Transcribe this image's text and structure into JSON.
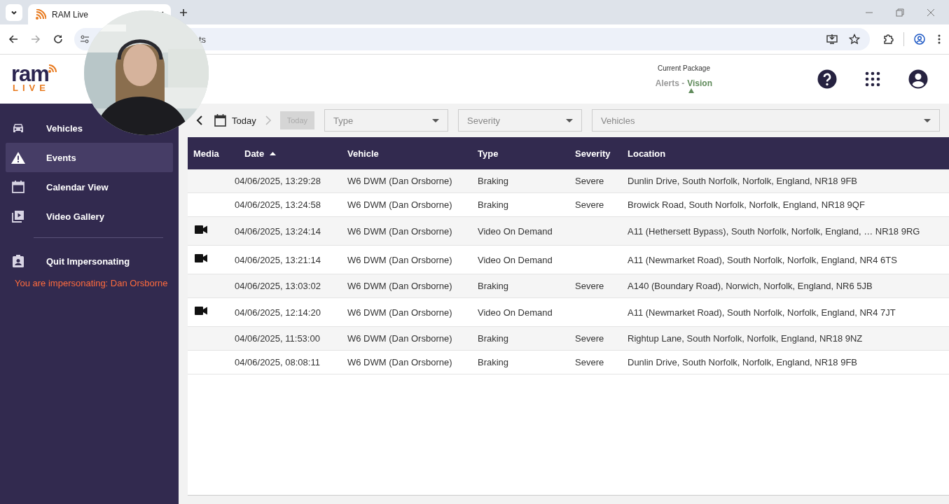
{
  "browser": {
    "tab_title": "RAM Live",
    "address": "ts"
  },
  "header": {
    "package_label": "Current Package",
    "package_base": "Alerts",
    "package_separator": "-",
    "package_tier": "Vision"
  },
  "logo": {
    "word": "ram",
    "sub": "LIVE"
  },
  "sidebar": {
    "items": [
      {
        "label": "Vehicles",
        "kind": "car",
        "selected": false
      },
      {
        "label": "Events",
        "kind": "warning",
        "selected": true
      },
      {
        "label": "Calendar View",
        "kind": "calendar",
        "selected": false
      },
      {
        "label": "Video Gallery",
        "kind": "video",
        "selected": false
      }
    ],
    "quit": {
      "label": "Quit Impersonating"
    },
    "notice": "You are impersonating: Dan Orsborne"
  },
  "filters": {
    "date": "Today",
    "date_end": "Today",
    "type": "Type",
    "severity": "Severity",
    "vehicles": "Vehicles"
  },
  "table": {
    "columns": [
      {
        "label": "Media",
        "sorted": false
      },
      {
        "label": "Date",
        "sorted": true
      },
      {
        "label": "Vehicle",
        "sorted": false
      },
      {
        "label": "Type",
        "sorted": false
      },
      {
        "label": "Severity",
        "sorted": false
      },
      {
        "label": "Location",
        "sorted": false
      }
    ],
    "rows": [
      {
        "video": false,
        "date": "04/06/2025, 13:29:28",
        "vehicle": "W6 DWM (Dan Orsborne)",
        "type": "Braking",
        "severity": "Severe",
        "location": "Dunlin Drive, South Norfolk, Norfolk, England, NR18 9FB"
      },
      {
        "video": false,
        "date": "04/06/2025, 13:24:58",
        "vehicle": "W6 DWM (Dan Orsborne)",
        "type": "Braking",
        "severity": "Severe",
        "location": "Browick Road, South Norfolk, Norfolk, England, NR18 9QF"
      },
      {
        "video": true,
        "date": "04/06/2025, 13:24:14",
        "vehicle": "W6 DWM (Dan Orsborne)",
        "type": "Video On Demand",
        "location": "A11 (Hethersett Bypass), South Norfolk, Norfolk, England, … NR18 9RG"
      },
      {
        "video": true,
        "date": "04/06/2025, 13:21:14",
        "vehicle": "W6 DWM (Dan Orsborne)",
        "type": "Video On Demand",
        "location": "A11 (Newmarket Road), South Norfolk, Norfolk, England, NR4 6TS"
      },
      {
        "video": false,
        "date": "04/06/2025, 13:03:02",
        "vehicle": "W6 DWM (Dan Orsborne)",
        "type": "Braking",
        "severity": "Severe",
        "location": "A140 (Boundary Road), Norwich, Norfolk, England, NR6 5JB"
      },
      {
        "video": true,
        "date": "04/06/2025, 12:14:20",
        "vehicle": "W6 DWM (Dan Orsborne)",
        "type": "Video On Demand",
        "location": "A11 (Newmarket Road), South Norfolk, Norfolk, England, NR4 7JT"
      },
      {
        "video": false,
        "date": "04/06/2025, 11:53:00",
        "vehicle": "W6 DWM (Dan Orsborne)",
        "type": "Braking",
        "severity": "Severe",
        "location": "Rightup Lane, South Norfolk, Norfolk, England, NR18 9NZ"
      },
      {
        "video": false,
        "date": "04/06/2025, 08:08:11",
        "vehicle": "W6 DWM (Dan Orsborne)",
        "type": "Braking",
        "severity": "Severe",
        "location": "Dunlin Drive, South Norfolk, Norfolk, England, NR18 9FB"
      }
    ]
  }
}
